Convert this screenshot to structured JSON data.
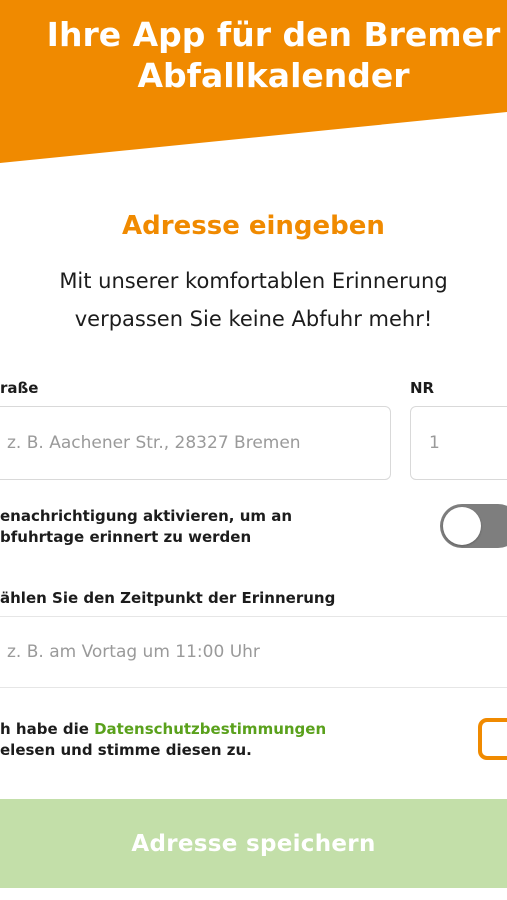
{
  "header": {
    "title": "Ihre App für den Bremer Abfallkalender",
    "color": "#f08a00"
  },
  "address_section": {
    "title": "Adresse eingeben",
    "subtitle": "Mit unserer komfortablen Erinnerung verpassen Sie keine Abfuhr mehr!"
  },
  "form": {
    "street_label": "raße",
    "street_placeholder": "z. B. Aachener Str., 28327 Bremen",
    "number_label": "NR",
    "number_placeholder": "1",
    "notification_line1": "enachrichtigung aktivieren, um an",
    "notification_line2": "bfuhrtage erinnert zu werden",
    "notification_enabled": false,
    "time_label": "ählen Sie den Zeitpunkt der Erinnerung",
    "time_placeholder": "z. B. am Vortag um 11:00 Uhr",
    "consent_prefix": "h habe die ",
    "consent_link": "Datenschutzbestimmungen",
    "consent_line2": "elesen und stimme diesen zu.",
    "consent_checked": false
  },
  "save_button": {
    "label": "Adresse speichern",
    "color": "#c3dfa9"
  }
}
